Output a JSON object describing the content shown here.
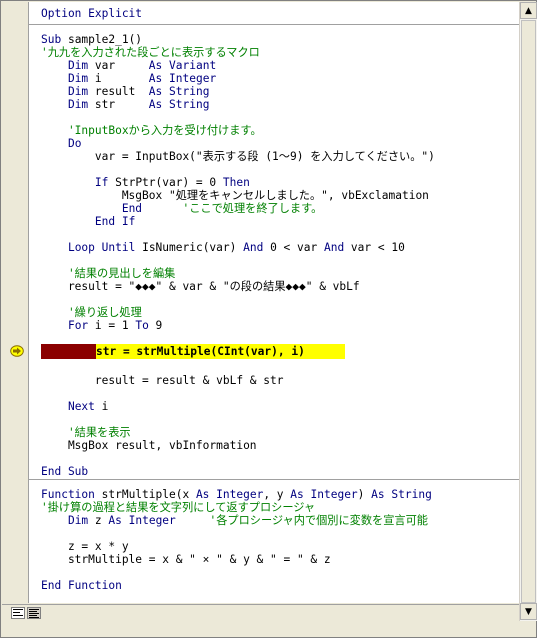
{
  "code_window": {
    "general_section": {
      "lines": [
        {
          "type": "keyword",
          "text": "Option Explicit"
        }
      ]
    },
    "sample_procedure": {
      "lines": [
        {
          "type": "code",
          "text": "Sub sample2_1()"
        },
        {
          "type": "comment",
          "text": "'九九を入力された段ごとに表示するマクロ"
        },
        {
          "type": "code",
          "text": "    Dim var     As Variant"
        },
        {
          "type": "code",
          "text": "    Dim i       As Integer"
        },
        {
          "type": "code",
          "text": "    Dim result  As String"
        },
        {
          "type": "code",
          "text": "    Dim str     As String"
        },
        {
          "type": "blank",
          "text": ""
        },
        {
          "type": "comment",
          "text": "    'InputBoxから入力を受け付けます。"
        },
        {
          "type": "code",
          "text": "    Do"
        },
        {
          "type": "code",
          "text": "        var = InputBox(\"表示する段 (1～9) を入力してください。\")"
        },
        {
          "type": "blank",
          "text": ""
        },
        {
          "type": "code",
          "text": "        If StrPtr(var) = 0 Then"
        },
        {
          "type": "code",
          "text": "            MsgBox \"処理をキャンセルしました。\", vbExclamation"
        },
        {
          "type": "mixed",
          "text": "            End",
          "comment": "      'ここで処理を終了します。"
        },
        {
          "type": "code",
          "text": "        End If"
        },
        {
          "type": "blank",
          "text": ""
        },
        {
          "type": "code",
          "text": "    Loop Until IsNumeric(var) And 0 < var And var < 10"
        },
        {
          "type": "blank",
          "text": ""
        },
        {
          "type": "comment",
          "text": "    '結果の見出しを編集"
        },
        {
          "type": "code",
          "text": "    result = \"◆◆◆\" & var & \"の段の結果◆◆◆\" & vbLf"
        },
        {
          "type": "blank",
          "text": ""
        },
        {
          "type": "comment",
          "text": "    '繰り返し処理"
        },
        {
          "type": "code",
          "text": "    For i = 1 To 9"
        },
        {
          "type": "blank",
          "text": ""
        },
        {
          "type": "current",
          "text": "str = strMultiple(CInt(var), i)"
        },
        {
          "type": "blank",
          "text": ""
        },
        {
          "type": "code",
          "text": "        result = result & vbLf & str"
        },
        {
          "type": "blank",
          "text": ""
        },
        {
          "type": "code",
          "text": "    Next i"
        },
        {
          "type": "blank",
          "text": ""
        },
        {
          "type": "comment",
          "text": "    '結果を表示"
        },
        {
          "type": "code",
          "text": "    MsgBox result, vbInformation"
        },
        {
          "type": "blank",
          "text": ""
        },
        {
          "type": "code",
          "text": "End Sub"
        }
      ]
    },
    "function_procedure": {
      "lines": [
        {
          "type": "code",
          "text": "Function strMultiple(x As Integer, y As Integer) As String"
        },
        {
          "type": "comment",
          "text": "'掛け算の過程と結果を文字列にして返すプロシージャ"
        },
        {
          "type": "mixed",
          "text": "    Dim z As Integer",
          "comment": "     '各プロシージャ内で個別に変数を宣言可能"
        },
        {
          "type": "blank",
          "text": ""
        },
        {
          "type": "code",
          "text": "    z = x * y"
        },
        {
          "type": "code",
          "text": "    strMultiple = x & \" × \" & y & \" = \" & z"
        },
        {
          "type": "blank",
          "text": ""
        },
        {
          "type": "code",
          "text": "End Function"
        }
      ]
    }
  },
  "colors": {
    "keyword": "#000080",
    "comment": "#008000",
    "breakpoint": "#8b0000",
    "current_line": "#ffff00",
    "exec_arrow": "#ffff00"
  },
  "icons": {
    "exec_pointer": "execution-arrow-icon",
    "procedure_view": "procedure-view-icon",
    "full_module_view": "full-module-view-icon"
  },
  "scrollbar": {
    "up_glyph": "▲",
    "down_glyph": "▼"
  }
}
